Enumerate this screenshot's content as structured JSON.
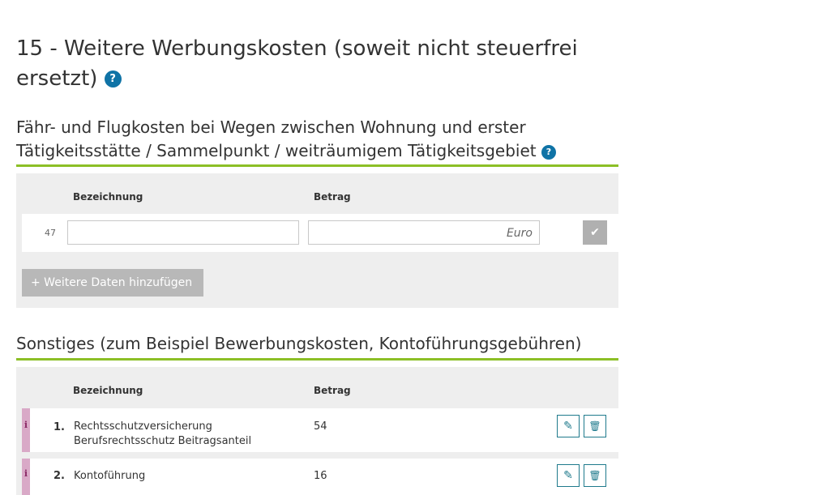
{
  "page": {
    "title": "15 - Weitere Werbungskosten (soweit nicht steuerfrei ersetzt)",
    "help_glyph": "?"
  },
  "section1": {
    "heading": "Fähr- und Flugkosten bei Wegen zwischen Wohnung und erster Tätigkeitsstätte / Sammelpunkt / weiträumigem Tätigkeitsgebiet",
    "col_description": "Bezeichnung",
    "col_amount": "Betrag",
    "row": {
      "line_number": "47",
      "description_value": "",
      "amount_value": "",
      "amount_suffix": "Euro",
      "confirm_glyph": "✔"
    },
    "add_button": "+  Weitere Daten hinzufügen"
  },
  "section2": {
    "heading": "Sonstiges (zum Beispiel Bewerbungskosten, Kontoführungsgebühren)",
    "col_description": "Bezeichnung",
    "col_amount": "Betrag",
    "info_glyph": "i",
    "edit_glyph": "✎",
    "delete_glyph": "🗑",
    "items": [
      {
        "number": "1.",
        "description": "Rechtsschutzversicherung Berufsrechtsschutz Beitragsanteil",
        "amount": "54"
      },
      {
        "number": "2.",
        "description": "Kontoführung",
        "amount": "16"
      }
    ]
  },
  "colors": {
    "accent_green": "#8cbf26",
    "help_blue": "#0f73a6",
    "action_teal": "#1f7a8c",
    "info_pink": "#d9a9c7"
  }
}
